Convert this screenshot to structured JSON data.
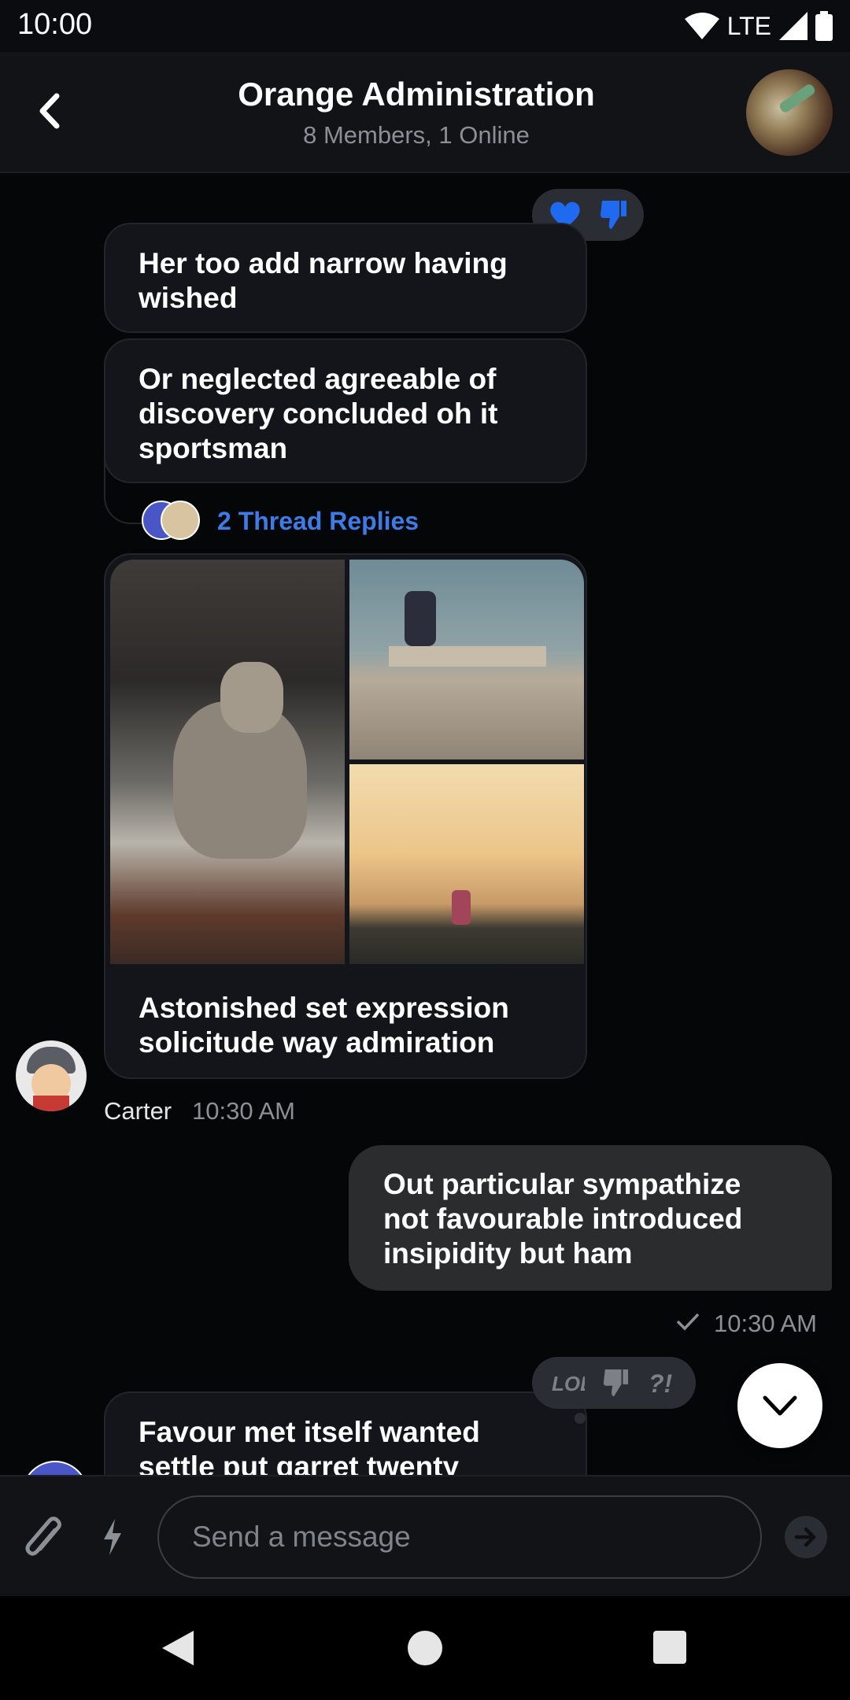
{
  "status_bar": {
    "time": "10:00",
    "network": "LTE"
  },
  "header": {
    "title": "Orange Administration",
    "subtitle": "8 Members, 1 Online"
  },
  "messages": {
    "m1": {
      "text": "Her too add narrow having wished",
      "reactions": [
        "heart-icon",
        "thumbs-down-icon"
      ]
    },
    "m2": {
      "text": "Or neglected agreeable of discovery concluded oh it sportsman",
      "thread_replies": "2 Thread Replies"
    },
    "m3": {
      "images": [
        "coyote-photo",
        "skateboarder-photo",
        "sunset-runner-photo"
      ],
      "text": "Astonished set expression solicitude way admiration",
      "author": "Carter",
      "time": "10:30 AM"
    },
    "m4": {
      "text": "Out particular sympathize not favourable introduced insipidity but ham",
      "time": "10:30 AM",
      "status": "sent"
    },
    "m5": {
      "text": "Favour met itself wanted settle put garret twenty",
      "reactions": [
        "lol-icon",
        "thumbs-down-icon",
        "wow-icon"
      ]
    }
  },
  "composer": {
    "placeholder": "Send a message"
  },
  "colors": {
    "accent": "#3f7be6",
    "background": "#050608",
    "bubble_other": "#13151a",
    "bubble_own": "#2b2c2e"
  }
}
